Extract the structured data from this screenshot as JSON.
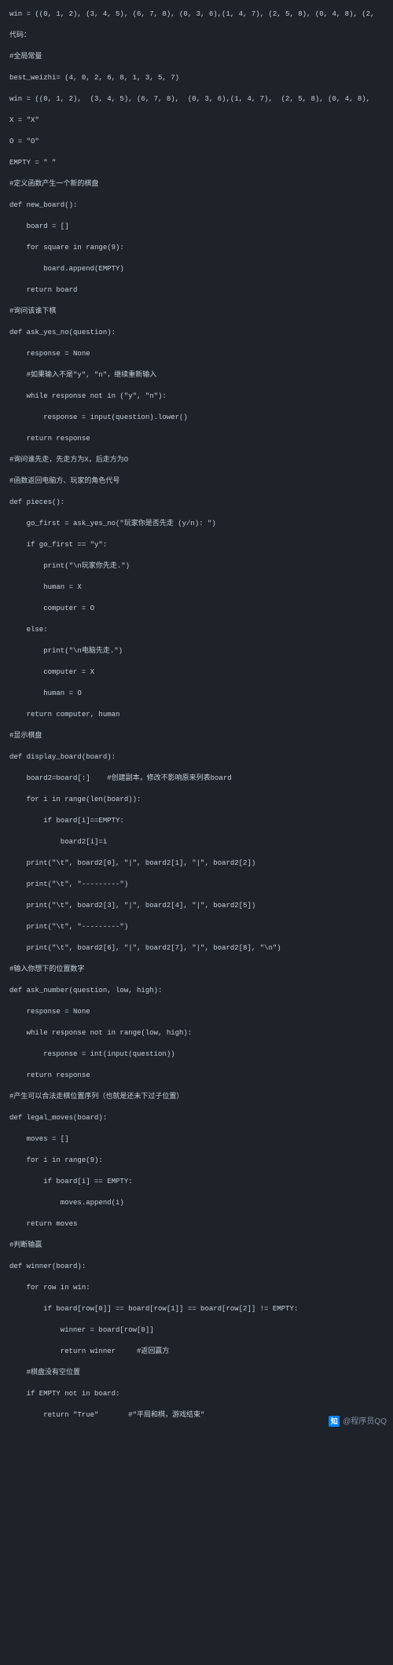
{
  "code_lines": [
    "win = ((0, 1, 2), (3, 4, 5), (6, 7, 8), (0, 3, 6),(1, 4, 7), (2, 5, 8), (0, 4, 8), (2,",
    "",
    "代码：",
    "",
    "#全局常量",
    "",
    "best_weizhi= (4, 0, 2, 6, 8, 1, 3, 5, 7)",
    "",
    "win = ((0, 1, 2),  (3, 4, 5), (6, 7, 8),  (0, 3, 6),(1, 4, 7),  (2, 5, 8), (0, 4, 8),",
    "",
    "X = \"X\"",
    "",
    "O = \"O\"",
    "",
    "EMPTY = \" \"",
    "",
    "#定义函数产生一个新的棋盘",
    "",
    "def new_board():",
    "",
    "    board = []",
    "",
    "    for square in range(9):",
    "",
    "        board.append(EMPTY)",
    "",
    "    return board",
    "",
    "#询问该谁下棋",
    "",
    "def ask_yes_no(question):",
    "",
    "    response = None",
    "",
    "    #如果输入不是\"y\", \"n\"，继续重新输入",
    "",
    "    while response not in (\"y\", \"n\"):",
    "",
    "        response = input(question).lower()",
    "",
    "    return response",
    "",
    "#询问谁先走，先走方为X，后走方为O",
    "",
    "#函数返回电脑方、玩家的角色代号",
    "",
    "def pieces():",
    "",
    "    go_first = ask_yes_no(\"玩家你是否先走 (y/n): \")",
    "",
    "    if go_first == \"y\":",
    "",
    "        print(\"\\n玩家你先走.\")",
    "",
    "        human = X",
    "",
    "        computer = O",
    "",
    "    else:",
    "",
    "        print(\"\\n电脑先走.\")",
    "",
    "        computer = X",
    "",
    "        human = O",
    "",
    "    return computer, human",
    "",
    "#显示棋盘",
    "",
    "def display_board(board):",
    "",
    "    board2=board[:]    #创建副本，修改不影响原来列表board",
    "",
    "    for i in range(len(board)):",
    "",
    "        if board[i]==EMPTY:",
    "",
    "            board2[i]=i",
    "",
    "    print(\"\\t\", board2[0], \"|\", board2[1], \"|\", board2[2])",
    "",
    "    print(\"\\t\", \"---------\")",
    "",
    "    print(\"\\t\", board2[3], \"|\", board2[4], \"|\", board2[5])",
    "",
    "    print(\"\\t\", \"---------\")",
    "",
    "    print(\"\\t\", board2[6], \"|\", board2[7], \"|\", board2[8], \"\\n\")",
    "",
    "#输入你想下的位置数字",
    "",
    "def ask_number(question, low, high):",
    "",
    "    response = None",
    "",
    "    while response not in range(low, high):",
    "",
    "        response = int(input(question))",
    "",
    "    return response",
    "",
    "#产生可以合法走棋位置序列（也就是还未下过子位置）",
    "",
    "def legal_moves(board):",
    "",
    "    moves = []",
    "",
    "    for i in range(9):",
    "",
    "        if board[i] == EMPTY:",
    "",
    "            moves.append(i)",
    "",
    "    return moves",
    "",
    "#判断输赢",
    "",
    "def winner(board):",
    "",
    "    for row in win:",
    "",
    "        if board[row[0]] == board[row[1]] == board[row[2]] != EMPTY:",
    "",
    "            winner = board[row[0]]",
    "",
    "            return winner     #返回赢方",
    "",
    "    #棋盘没有空位置",
    "",
    "    if EMPTY not in board:",
    "",
    "        return \"True\"       #\"平局和棋，游戏结束\""
  ],
  "attribution": {
    "icon_text": "知",
    "label": "@程序员QQ"
  }
}
